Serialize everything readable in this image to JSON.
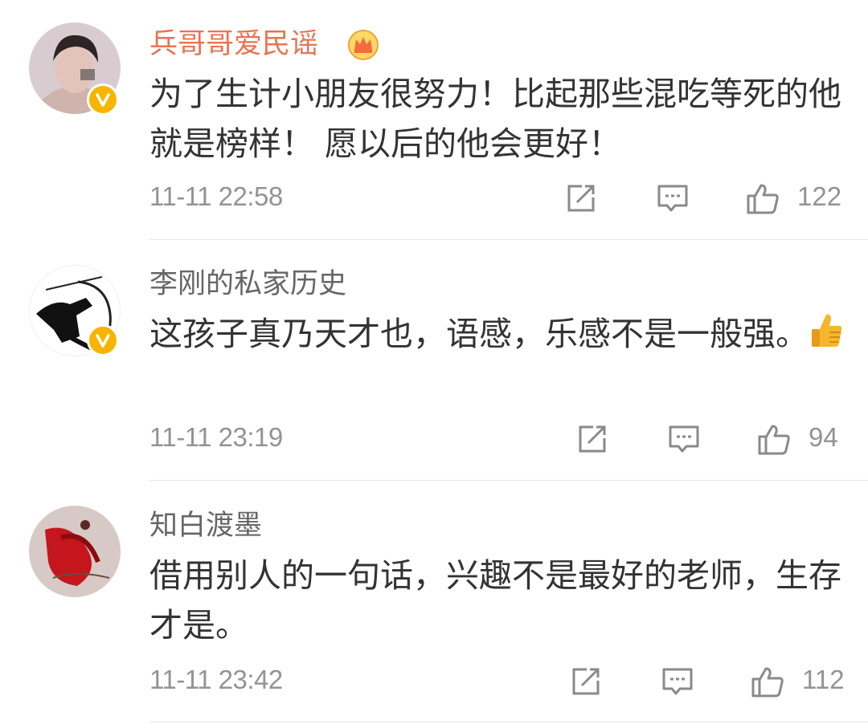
{
  "comments": [
    {
      "username": "兵哥哥爱民谣",
      "text": "为了生计小朋友很努力！比起那些混吃等死的他就是榜样！  愿以后的他会更好！",
      "time": "11-11 22:58",
      "likes": "122",
      "verified": true,
      "member_crown": true,
      "name_color": "#eb7350"
    },
    {
      "username": "李刚的私家历史",
      "text": "这孩子真乃天才也，语感，乐感不是一般强。",
      "emoji": "thumbs-up-emoji",
      "time": "11-11 23:19",
      "likes": "94",
      "verified": true
    },
    {
      "username": "知白渡墨",
      "text": "借用别人的一句话，兴趣不是最好的老师，生存才是。",
      "time": "11-11 23:42",
      "likes": "112",
      "verified": false
    }
  ],
  "icons": {
    "repost": "repost-icon",
    "reply": "comment-icon",
    "like": "like-icon"
  },
  "colors": {
    "verified_badge": "#f7b500",
    "meta_text": "#939393",
    "body_text": "#333333"
  }
}
